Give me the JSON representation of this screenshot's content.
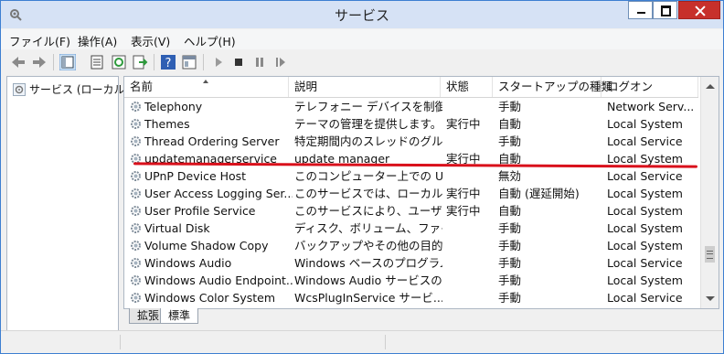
{
  "window": {
    "title": "サービス"
  },
  "menu": [
    "ファイル(F)",
    "操作(A)",
    "表示(V)",
    "ヘルプ(H)"
  ],
  "toolbar": [
    "back-arrow-icon",
    "forward-arrow-icon",
    "console-tree-icon",
    "properties-icon",
    "refresh-icon",
    "export-list-icon",
    "help-icon",
    "panel-icon",
    "play-icon",
    "stop-icon",
    "pause-icon",
    "restart-icon"
  ],
  "tree": {
    "label": "サービス (ローカル)"
  },
  "columns": {
    "name": "名前",
    "description": "説明",
    "state": "状態",
    "startup": "スタートアップの種類",
    "logon": "ログオン"
  },
  "services": [
    {
      "name": "Telephony",
      "description": "テレフォニー デバイスを制御す...",
      "state": "",
      "startup": "手動",
      "logon": "Network Serv..."
    },
    {
      "name": "Themes",
      "description": "テーマの管理を提供します。",
      "state": "実行中",
      "startup": "自動",
      "logon": "Local System"
    },
    {
      "name": "Thread Ordering Server",
      "description": "特定期間内のスレッドのグルー...",
      "state": "",
      "startup": "手動",
      "logon": "Local Service"
    },
    {
      "name": "updatemanagerservice",
      "description": "update manager",
      "state": "実行中",
      "startup": "自動",
      "logon": "Local System",
      "highlighted": true
    },
    {
      "name": "UPnP Device Host",
      "description": "このコンピューター上での UPn...",
      "state": "",
      "startup": "無効",
      "logon": "Local Service"
    },
    {
      "name": "User Access Logging Ser...",
      "description": "このサービスでは、ローカル サ...",
      "state": "実行中",
      "startup": "自動 (遅延開始)",
      "logon": "Local System"
    },
    {
      "name": "User Profile Service",
      "description": "このサービスにより、ユーザー プ...",
      "state": "実行中",
      "startup": "自動",
      "logon": "Local System"
    },
    {
      "name": "Virtual Disk",
      "description": "ディスク、ボリューム、ファイル ...",
      "state": "",
      "startup": "手動",
      "logon": "Local System"
    },
    {
      "name": "Volume Shadow Copy",
      "description": "バックアップやその他の目的で...",
      "state": "",
      "startup": "手動",
      "logon": "Local System"
    },
    {
      "name": "Windows Audio",
      "description": "Windows ベースのプログラム...",
      "state": "",
      "startup": "手動",
      "logon": "Local Service"
    },
    {
      "name": "Windows Audio Endpoint...",
      "description": "Windows Audio サービスの...",
      "state": "",
      "startup": "手動",
      "logon": "Local System"
    },
    {
      "name": "Windows Color System",
      "description": "WcsPlugInService サービ...",
      "state": "",
      "startup": "手動",
      "logon": "Local Service"
    }
  ],
  "tabs": [
    "拡張",
    "標準"
  ],
  "colors": {
    "highlight_line": "#d9101b",
    "title_bar": "#d6e2f5",
    "close_button": "#c7302b"
  }
}
